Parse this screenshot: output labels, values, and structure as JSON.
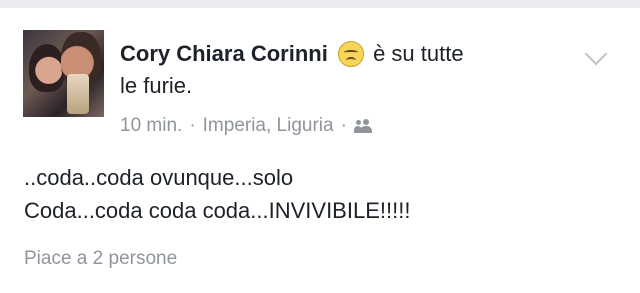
{
  "post": {
    "author": "Cory Chiara Corinni",
    "feeling_icon": "angry-face-emoji",
    "feeling_text_1": "è su tutte",
    "feeling_text_2": "le furie.",
    "time": "10 min.",
    "separator": "·",
    "location": "Imperia, Liguria",
    "audience_icon": "friends-icon",
    "text_line_1": "..coda..coda ovunque...solo",
    "text_line_2": "Coda...coda coda coda...INVIVIBILE!!!!!",
    "likes": "Piace a 2 persone"
  }
}
